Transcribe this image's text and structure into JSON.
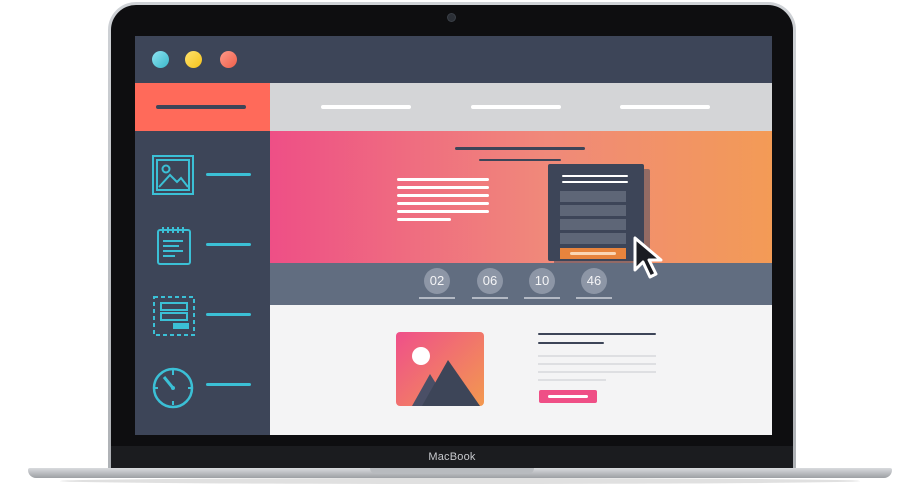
{
  "device": {
    "brand_label": "MacBook"
  },
  "window": {
    "controls": [
      "close",
      "minimize",
      "maximize"
    ]
  },
  "sidebar": {
    "items": [
      {
        "icon": "image-icon"
      },
      {
        "icon": "notepad-icon"
      },
      {
        "icon": "layout-icon"
      },
      {
        "icon": "timer-icon"
      }
    ]
  },
  "countdown": {
    "values": [
      "02",
      "06",
      "10",
      "46"
    ]
  },
  "colors": {
    "titlebar": "#3d4558",
    "sidebar_header": "#ff6a5a",
    "accent_cyan": "#3bc0d6",
    "hero_gradient_start": "#ee4f86",
    "hero_gradient_end": "#f39b56",
    "form_button": "#e8843d",
    "cta_button": "#ef4f86"
  }
}
